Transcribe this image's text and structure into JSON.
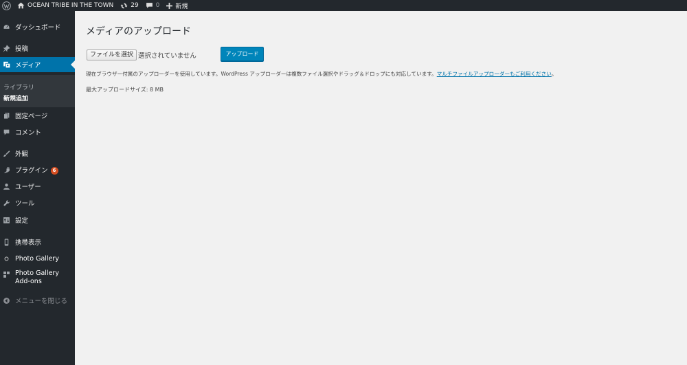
{
  "adminbar": {
    "site_name": "OCEAN TRIBE IN THE TOWN",
    "updates_count": "29",
    "comments_count": "0",
    "new_label": "新規"
  },
  "sidebar": {
    "items": [
      {
        "label": "ダッシュボード",
        "icon": "dashboard-icon"
      },
      {
        "label": "投稿",
        "icon": "pin-icon"
      },
      {
        "label": "メディア",
        "icon": "media-icon"
      },
      {
        "label": "固定ページ",
        "icon": "page-icon"
      },
      {
        "label": "コメント",
        "icon": "comment-icon"
      },
      {
        "label": "外観",
        "icon": "brush-icon"
      },
      {
        "label": "プラグイン",
        "icon": "plugin-icon",
        "badge": "6"
      },
      {
        "label": "ユーザー",
        "icon": "user-icon"
      },
      {
        "label": "ツール",
        "icon": "wrench-icon"
      },
      {
        "label": "設定",
        "icon": "settings-icon"
      },
      {
        "label": "携帯表示",
        "icon": "mobile-icon"
      },
      {
        "label": "Photo Gallery",
        "icon": "circle-icon"
      },
      {
        "label": "Photo Gallery Add-ons",
        "icon": "puzzle-icon"
      }
    ],
    "submenu": [
      {
        "label": "ライブラリ"
      },
      {
        "label": "新規追加"
      }
    ],
    "collapse_label": "メニューを閉じる"
  },
  "main": {
    "title": "メディアのアップロード",
    "file_button": "ファイルを選択",
    "file_status": "選択されていません",
    "upload_button": "アップロード",
    "info_text": "現在ブラウザー付属のアップローダーを使用しています。WordPress アップローダーは複数ファイル選択やドラッグ＆ドロップにも対応しています。",
    "info_link": "マルチファイルアップローダーもご利用ください",
    "info_link_end": "。",
    "max_size": "最大アップロードサイズ: 8 MB"
  },
  "colors": {
    "admin_bg": "#23282d",
    "submenu_bg": "#32373c",
    "accent": "#0073aa",
    "primary_button": "#0085ba",
    "badge": "#d54e21",
    "content_bg": "#f1f1f1"
  }
}
